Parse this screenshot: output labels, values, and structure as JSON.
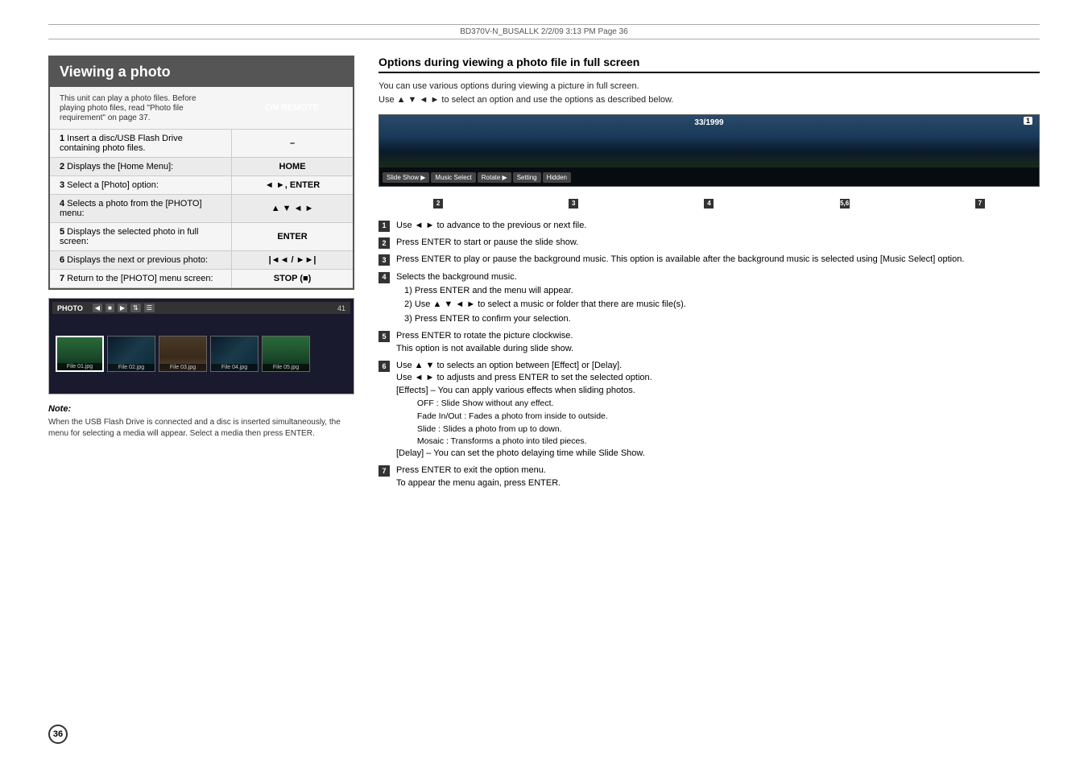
{
  "page": {
    "header": "BD370V-N_BUSALLK   2/2/09   3:13 PM   Page 36",
    "page_number": "36"
  },
  "left": {
    "section_title": "Viewing a photo",
    "description": "This unit can play a photo files. Before playing photo files, read \"Photo file requirement\" on page 37.",
    "on_remote_header": "ON REMOTE",
    "steps": [
      {
        "num": "1",
        "label": "Insert a disc/USB Flash Drive containing photo files.",
        "remote": "–"
      },
      {
        "num": "2",
        "label": "Displays the [Home Menu]:",
        "remote": "HOME"
      },
      {
        "num": "3",
        "label": "Select a [Photo] option:",
        "remote": "◄ ►, ENTER"
      },
      {
        "num": "4",
        "label": "Selects a photo from the [PHOTO] menu:",
        "remote": "▲ ▼ ◄ ►"
      },
      {
        "num": "5",
        "label": "Displays the selected photo in full screen:",
        "remote": "ENTER"
      },
      {
        "num": "6",
        "label": "Displays the next or previous photo:",
        "remote": "|◄◄ / ►►|"
      },
      {
        "num": "7",
        "label": "Return to the [PHOTO] menu screen:",
        "remote": "STOP (■)"
      }
    ],
    "photo_bar_title": "PHOTO",
    "photo_counter": "41",
    "thumbnails": [
      {
        "label": "File 01.jpg",
        "type": "trees"
      },
      {
        "label": "File 02.jpg",
        "type": "dark"
      },
      {
        "label": "File 03.jpg",
        "type": "person"
      },
      {
        "label": "File 04.jpg",
        "type": "dark"
      },
      {
        "label": "File 05.jpg",
        "type": "trees"
      }
    ],
    "note_title": "Note:",
    "note_text": "When the USB Flash Drive is connected and a disc is inserted simultaneously, the menu for selecting a media will appear. Select a media then press ENTER."
  },
  "right": {
    "section_title": "Options during viewing a photo file in full screen",
    "intro_line1": "You can use various options during viewing a picture in full screen.",
    "intro_line2": "Use ▲ ▼ ◄ ► to select an option and use the options as described below.",
    "preview": {
      "counter": "33/1999",
      "number_badge": "1",
      "toolbar_buttons": [
        {
          "label": "Slide Show ▶",
          "num": "2"
        },
        {
          "label": "Music Select",
          "num": "3"
        },
        {
          "label": "Rotate ▶",
          "num": "4"
        },
        {
          "label": "Setting",
          "num": "5,6"
        },
        {
          "label": "Hidden",
          "num": "7"
        }
      ]
    },
    "items": [
      {
        "num": "1",
        "text": "Use ◄ ► to advance to the previous or next file."
      },
      {
        "num": "2",
        "text": "Press ENTER to start or pause the slide show."
      },
      {
        "num": "3",
        "text": "Press ENTER to play or pause the background music. This option is available after the background music is selected using [Music Select] option."
      },
      {
        "num": "4",
        "text": "Selects the background music.",
        "sub_items": [
          "1)  Press ENTER and the menu will appear.",
          "2)  Use ▲ ▼ ◄ ► to select a music or folder that there are music file(s).",
          "3)  Press ENTER to confirm your selection."
        ]
      },
      {
        "num": "5",
        "text": "Press ENTER to rotate the picture clockwise.",
        "extra": "This option is not available during slide show."
      },
      {
        "num": "6",
        "text": "Use ▲ ▼ to selects an option between [Effect] or [Delay].",
        "extra2": "Use ◄ ► to adjusts and press ENTER to set the selected option.",
        "extra3": "[Effects] – You can apply various effects when sliding photos.",
        "sub_effects": [
          "OFF : Slide Show without any effect.",
          "Fade In/Out : Fades a photo from inside to outside.",
          "Slide : Slides a photo from up to down.",
          "Mosaic : Transforms a photo into tiled pieces."
        ],
        "extra4": "[Delay] – You can set the photo delaying time while Slide Show."
      },
      {
        "num": "7",
        "text": "Press ENTER to exit the option menu.",
        "extra": "To appear the menu again, press ENTER."
      }
    ]
  }
}
